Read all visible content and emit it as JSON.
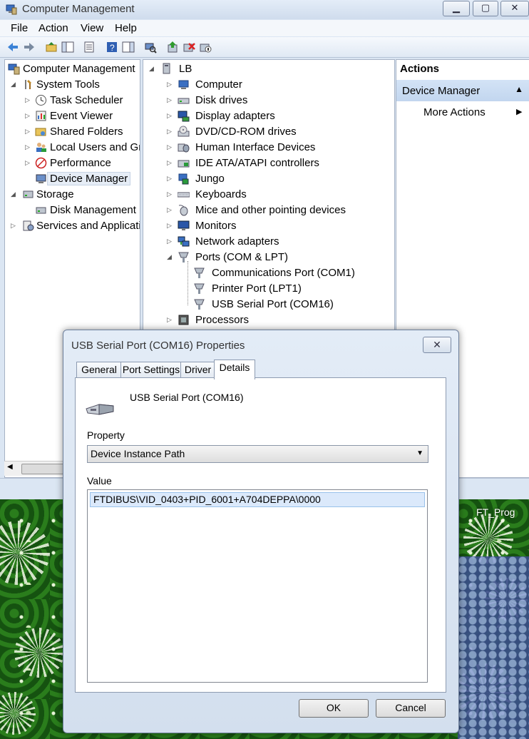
{
  "window": {
    "title": "Computer Management",
    "controls": {
      "minimize": "▁",
      "maximize": "▢",
      "close": "✕"
    }
  },
  "menu": [
    "File",
    "Action",
    "View",
    "Help"
  ],
  "left_tree": {
    "root": "Computer Management",
    "items": [
      "System Tools",
      "Task Scheduler",
      "Event Viewer",
      "Shared Folders",
      "Local Users and Groups",
      "Performance",
      "Device Manager",
      "Storage",
      "Disk Management",
      "Services and Applications"
    ]
  },
  "device_tree": {
    "root": "LB",
    "categories": [
      "Computer",
      "Disk drives",
      "Display adapters",
      "DVD/CD-ROM drives",
      "Human Interface Devices",
      "IDE ATA/ATAPI controllers",
      "Jungo",
      "Keyboards",
      "Mice and other pointing devices",
      "Monitors",
      "Network adapters",
      "Ports (COM & LPT)",
      "Processors"
    ],
    "ports_children": [
      "Communications Port (COM1)",
      "Printer Port (LPT1)",
      "USB Serial Port (COM16)"
    ]
  },
  "actions": {
    "header": "Actions",
    "section": "Device Manager",
    "more": "More Actions"
  },
  "dialog": {
    "title": "USB Serial Port (COM16) Properties",
    "tabs": [
      "General",
      "Port Settings",
      "Driver",
      "Details"
    ],
    "device_name": "USB Serial Port (COM16)",
    "property_label": "Property",
    "property_value": "Device Instance Path",
    "value_label": "Value",
    "value_items": [
      "FTDIBUS\\VID_0403+PID_6001+A704DEPPA\\0000"
    ],
    "ok": "OK",
    "cancel": "Cancel"
  },
  "desktop": {
    "label": "FT_Prog"
  },
  "colors": {
    "selection": "#dbe9fb",
    "actions_bar": "#c2d6ef",
    "desktop": "#1d5a13"
  }
}
